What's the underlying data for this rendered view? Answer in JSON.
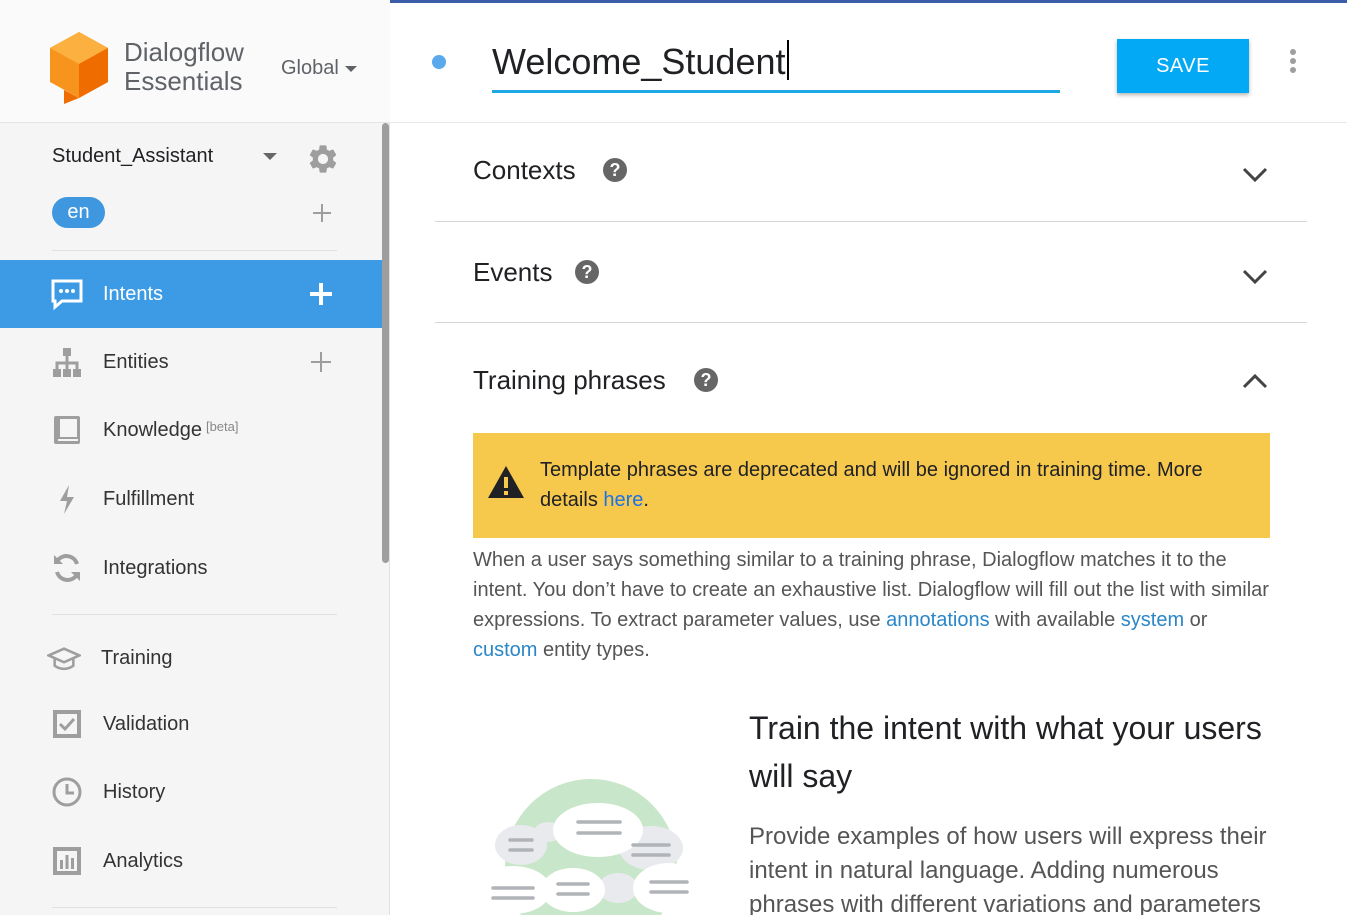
{
  "brand": {
    "name_line1": "Dialogflow",
    "name_line2": "Essentials",
    "region": "Global"
  },
  "agent": {
    "name": "Student_Assistant",
    "language": "en"
  },
  "nav": {
    "intents": "Intents",
    "entities": "Entities",
    "knowledge": "Knowledge",
    "knowledge_badge": "[beta]",
    "fulfillment": "Fulfillment",
    "integrations": "Integrations",
    "training": "Training",
    "validation": "Validation",
    "history": "History",
    "analytics": "Analytics"
  },
  "header": {
    "intent_name": "Welcome_Student",
    "save_label": "SAVE"
  },
  "sections": {
    "contexts": "Contexts",
    "events": "Events",
    "training_phrases": "Training phrases",
    "help_glyph": "?"
  },
  "warning": {
    "text": "Template phrases are deprecated and will be ignored in training time. More details ",
    "link": "here",
    "end": "."
  },
  "description": {
    "part1": "When a user says something similar to a training phrase, Dialogflow matches it to the intent. You don’t have to create an exhaustive list. Dialogflow will fill out the list with similar expressions. To extract parameter values, use ",
    "link_annotations": "annotations",
    "part2": " with available ",
    "link_system": "system",
    "part3": " or ",
    "link_custom": "custom",
    "part4": " entity types."
  },
  "empty_state": {
    "title": "Train the intent with what your users will say",
    "body": "Provide examples of how users will express their intent in natural language. Adding numerous phrases with different variations and parameters"
  },
  "colors": {
    "active_nav": "#3d9be5",
    "save_button": "#03a9f4",
    "warning_bg": "#f6c84c",
    "link": "#1a73e8",
    "logo": "#f7941d"
  }
}
